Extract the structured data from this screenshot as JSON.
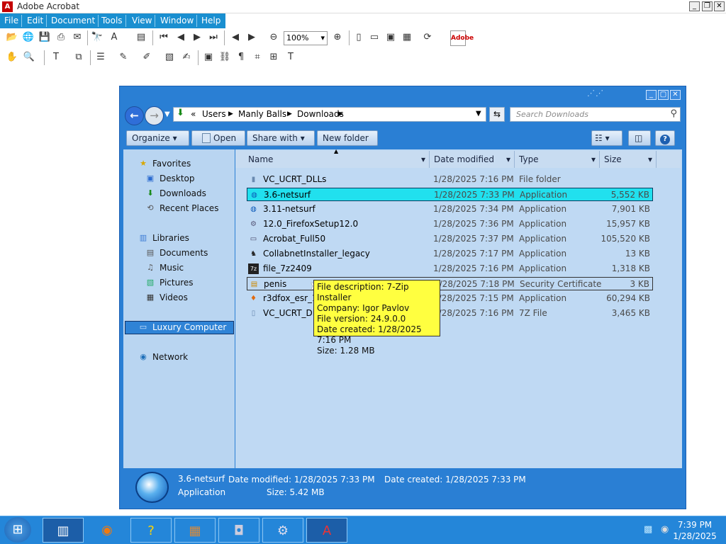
{
  "app": {
    "title": "Adobe Acrobat"
  },
  "menu": [
    "File",
    "Edit",
    "Document",
    "Tools",
    "View",
    "Window",
    "Help"
  ],
  "toolbar": {
    "zoom": "100%",
    "adobe_label": "Adobe"
  },
  "explorer": {
    "breadcrumb": [
      "Users",
      "Manly Balls",
      "Downloads"
    ],
    "search_placeholder": "Search Downloads",
    "commands": {
      "organize": "Organize",
      "open": "Open",
      "share": "Share with",
      "new_folder": "New folder"
    },
    "nav": {
      "favorites": "Favorites",
      "desktop": "Desktop",
      "downloads": "Downloads",
      "recent": "Recent Places",
      "libraries": "Libraries",
      "documents": "Documents",
      "music": "Music",
      "pictures": "Pictures",
      "videos": "Videos",
      "computer": "Luxury Computer",
      "network": "Network"
    },
    "columns": {
      "name": "Name",
      "date": "Date modified",
      "type": "Type",
      "size": "Size"
    },
    "files": [
      {
        "name": "VC_UCRT_DLLs",
        "date": "1/28/2025 7:16 PM",
        "type": "File folder",
        "size": "",
        "icon": "folder-icon"
      },
      {
        "name": "3.6-netsurf",
        "date": "1/28/2025 7:33 PM",
        "type": "Application",
        "size": "5,552 KB",
        "icon": "globe-icon"
      },
      {
        "name": "3.11-netsurf",
        "date": "1/28/2025 7:34 PM",
        "type": "Application",
        "size": "7,901 KB",
        "icon": "globe-icon"
      },
      {
        "name": "12.0_FirefoxSetup12.0",
        "date": "1/28/2025 7:36 PM",
        "type": "Application",
        "size": "15,957 KB",
        "icon": "installer-icon"
      },
      {
        "name": "Acrobat_Full50",
        "date": "1/28/2025 7:37 PM",
        "type": "Application",
        "size": "105,520 KB",
        "icon": "app-icon"
      },
      {
        "name": "CollabnetInstaller_legacy",
        "date": "1/28/2025 7:17 PM",
        "type": "Application",
        "size": "13 KB",
        "icon": "app-icon"
      },
      {
        "name": "file_7z2409",
        "date": "1/28/2025 7:16 PM",
        "type": "Application",
        "size": "1,318 KB",
        "icon": "7zip-icon"
      },
      {
        "name": "penis",
        "date": "1/28/2025 7:18 PM",
        "type": "Security Certificate",
        "size": "3 KB",
        "icon": "certificate-icon"
      },
      {
        "name": "r3dfox_esr_12",
        "date": "1/28/2025 7:15 PM",
        "type": "Application",
        "size": "60,294 KB",
        "icon": "fox-icon"
      },
      {
        "name": "VC_UCRT_DL",
        "date": "1/28/2025 7:16 PM",
        "type": "7Z File",
        "size": "3,465 KB",
        "icon": "file-icon"
      }
    ],
    "tooltip": {
      "desc": "File description: 7-Zip Installer",
      "company": "Company: Igor Pavlov",
      "version": "File version: 24.9.0.0",
      "created": "Date created: 1/28/2025 7:16 PM",
      "size": "Size: 1.28 MB"
    },
    "details": {
      "name": "3.6-netsurf",
      "kind": "Application",
      "modified": "Date modified: 1/28/2025 7:33 PM",
      "created": "Date created: 1/28/2025 7:33 PM",
      "size": "Size: 5.42 MB"
    }
  },
  "taskbar": {
    "time": "7:39 PM",
    "date": "1/28/2025"
  }
}
